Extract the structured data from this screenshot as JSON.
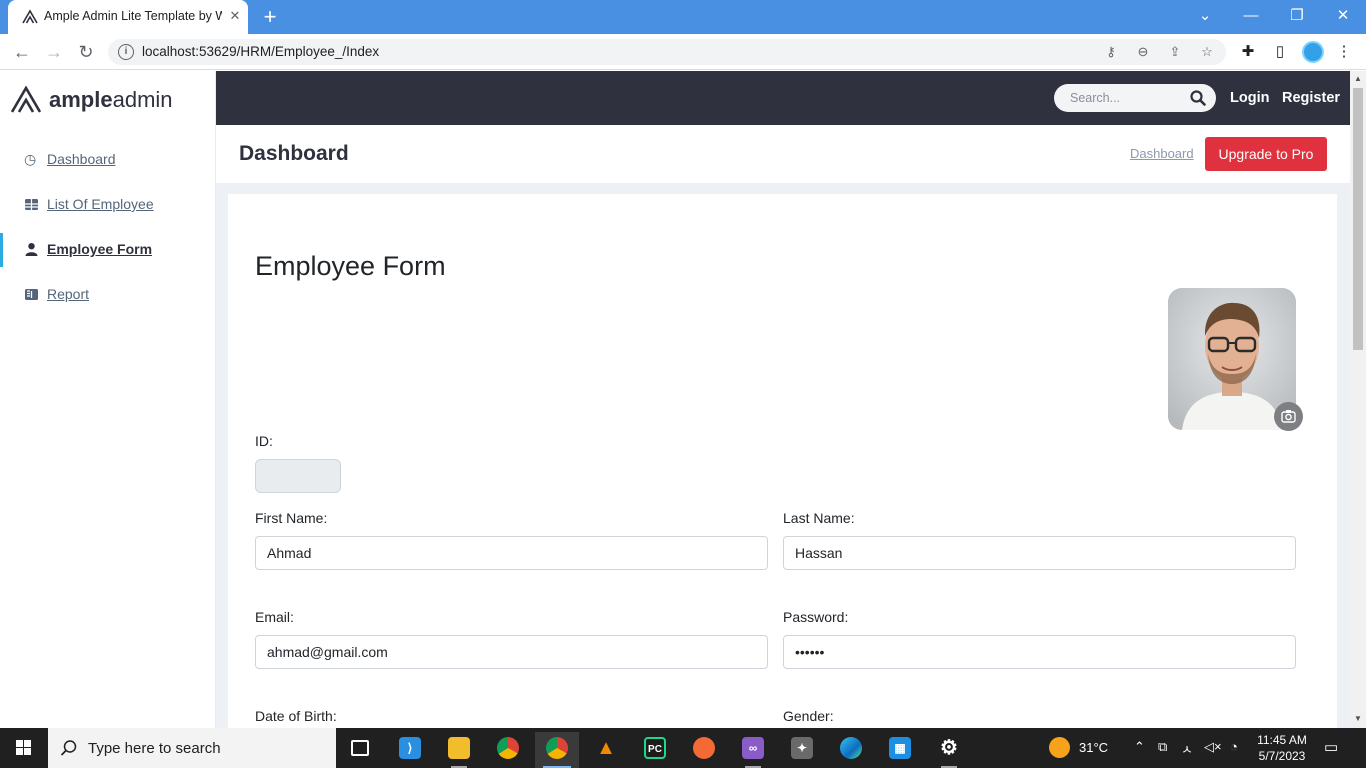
{
  "browser": {
    "tab_title": "Ample Admin Lite Template by W",
    "tab_close": "✕",
    "new_tab": "+",
    "url": "localhost:53629/HRM/Employee_/Index"
  },
  "app": {
    "logo_bold": "ample",
    "logo_light": "admin",
    "sidebar": {
      "items": [
        {
          "label": "Dashboard",
          "icon": "clock-icon"
        },
        {
          "label": "List Of Employee",
          "icon": "table-icon"
        },
        {
          "label": "Employee Form",
          "icon": "user-icon",
          "active": true
        },
        {
          "label": "Report",
          "icon": "columns-icon"
        }
      ]
    },
    "topbar": {
      "search_placeholder": "Search...",
      "login": "Login",
      "register": "Register"
    },
    "page_header": {
      "title": "Dashboard",
      "breadcrumb": "Dashboard",
      "upgrade_button": "Upgrade to Pro"
    },
    "form": {
      "title": "Employee Form",
      "id_label": "ID:",
      "id_value": "",
      "first_name_label": "First Name:",
      "first_name_value": "Ahmad",
      "last_name_label": "Last Name:",
      "last_name_value": "Hassan",
      "email_label": "Email:",
      "email_value": "ahmad@gmail.com",
      "password_label": "Password:",
      "password_value": "123456",
      "dob_label": "Date of Birth:",
      "gender_label": "Gender:"
    }
  },
  "taskbar": {
    "search_text": "Type here to search",
    "weather": "31°C",
    "time": "11:45 AM",
    "date": "5/7/2023"
  },
  "colors": {
    "accent": "#2cabe3",
    "topbar": "#2f323e",
    "upgrade": "#e0323e",
    "browser_frame": "#4a90e2"
  }
}
